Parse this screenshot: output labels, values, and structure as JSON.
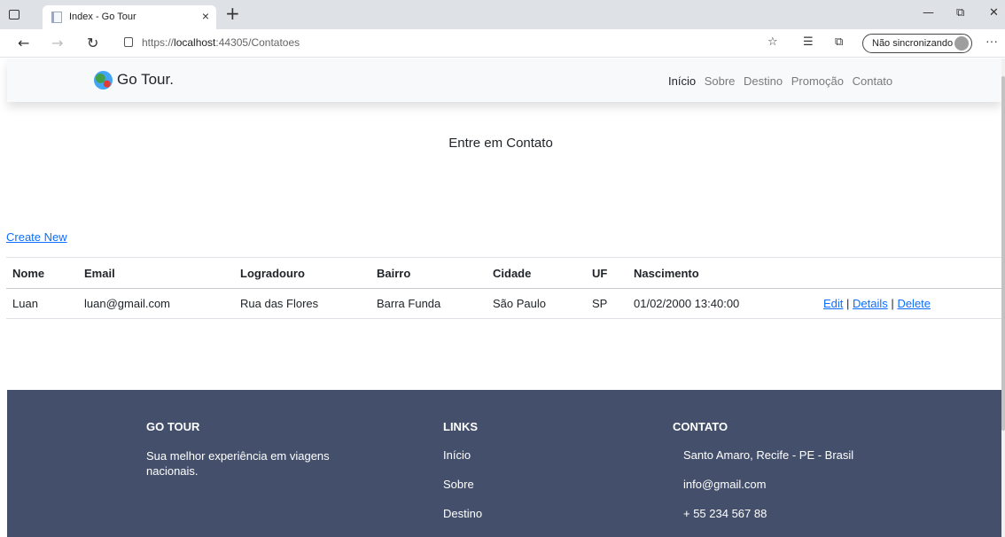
{
  "browser": {
    "tab_title": "Index - Go Tour",
    "tab_close": "×",
    "new_tab": "+",
    "url_prefix": "https://",
    "url_host": "localhost",
    "url_path": ":44305/Contatoes",
    "sync_label": "Não sincronizando",
    "minimize": "—",
    "restore": "⧉",
    "close": "✕",
    "back": "←",
    "forward": "→",
    "refresh": "↻",
    "more": "···"
  },
  "navbar": {
    "brand": "Go Tour.",
    "links": [
      "Início",
      "Sobre",
      "Destino",
      "Promoção",
      "Contato"
    ]
  },
  "main": {
    "heading": "Entre em Contato",
    "create_link": "Create New",
    "table": {
      "headers": [
        "Nome",
        "Email",
        "Logradouro",
        "Bairro",
        "Cidade",
        "UF",
        "Nascimento",
        ""
      ],
      "rows": [
        {
          "nome": "Luan",
          "email": "luan@gmail.com",
          "logradouro": "Rua das Flores",
          "bairro": "Barra Funda",
          "cidade": "São Paulo",
          "uf": "SP",
          "nascimento": "01/02/2000 13:40:00",
          "edit": "Edit",
          "details": "Details",
          "delete": "Delete",
          "sep": "|"
        }
      ]
    }
  },
  "footer": {
    "col1": {
      "title": "GO TOUR",
      "text": "Sua melhor experiência em viagens nacionais."
    },
    "col2": {
      "title": "LINKS",
      "items": [
        "Início",
        "Sobre",
        "Destino"
      ]
    },
    "col3": {
      "title": "CONTATO",
      "items": [
        "Santo Amaro, Recife - PE - Brasil",
        "info@gmail.com",
        "+ 55 234 567 88"
      ]
    }
  }
}
